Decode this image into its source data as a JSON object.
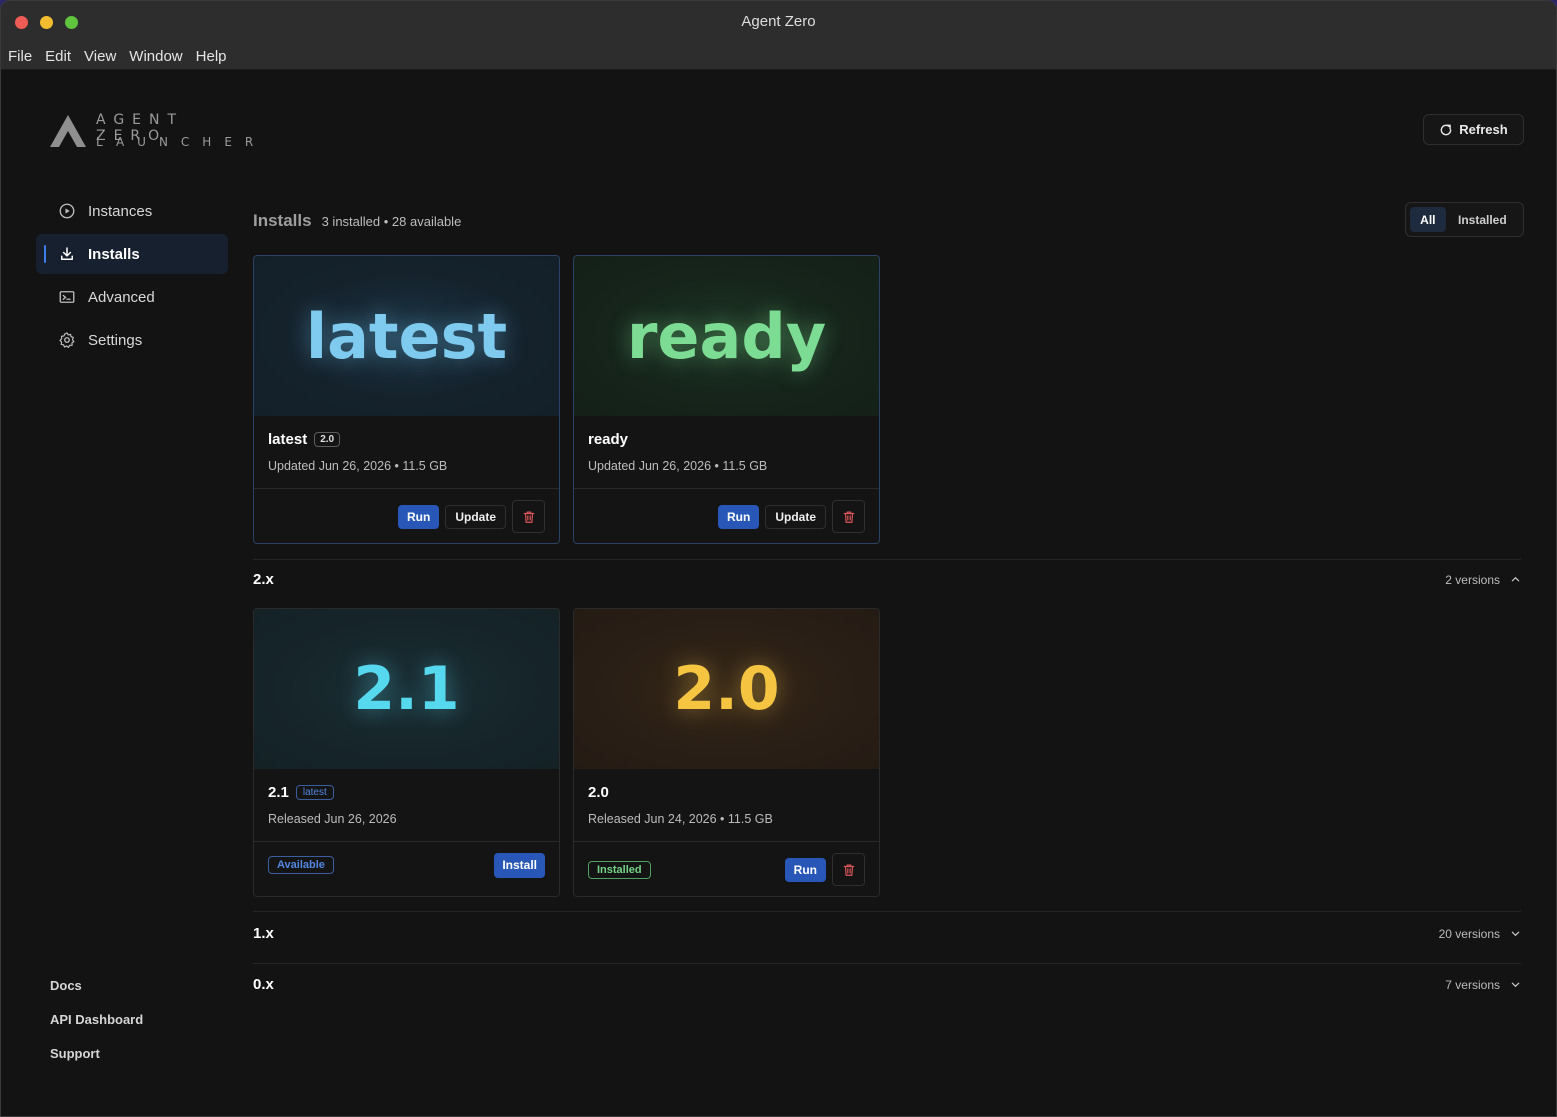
{
  "window": {
    "title": "Agent Zero"
  },
  "menu": [
    "File",
    "Edit",
    "View",
    "Window",
    "Help"
  ],
  "logo": {
    "line1": "AGENT ZERO",
    "line2": "LAUNCHER"
  },
  "refresh_label": "Refresh",
  "sidebar": {
    "items": [
      {
        "label": "Instances",
        "icon": "play-circle-icon"
      },
      {
        "label": "Installs",
        "icon": "download-icon",
        "active": true
      },
      {
        "label": "Advanced",
        "icon": "terminal-icon"
      },
      {
        "label": "Settings",
        "icon": "gear-icon"
      }
    ],
    "footer": [
      "Docs",
      "API Dashboard",
      "Support"
    ]
  },
  "installs": {
    "title": "Installs",
    "count": "3 installed • 28 available",
    "filters": {
      "all": "All",
      "installed": "Installed",
      "selected": "All"
    }
  },
  "cards": {
    "latest": {
      "hero": "latest",
      "title": "latest",
      "badge": "2.0",
      "meta": "Updated Jun 26, 2026 • 11.5 GB",
      "run": "Run",
      "update": "Update",
      "hero_color": "#7ecbef"
    },
    "ready": {
      "hero": "ready",
      "title": "ready",
      "meta": "Updated Jun 26, 2026 • 11.5 GB",
      "run": "Run",
      "update": "Update",
      "hero_color": "#7ddc93"
    },
    "v21": {
      "hero": "2.1",
      "title": "2.1",
      "badge": "latest",
      "meta": "Released Jun 26, 2026",
      "status": "Available",
      "install": "Install",
      "hero_color": "#56d8ee"
    },
    "v20": {
      "hero": "2.0",
      "title": "2.0",
      "meta": "Released Jun 24, 2026 • 11.5 GB",
      "status": "Installed",
      "run": "Run",
      "hero_color": "#f5c542"
    }
  },
  "groups": [
    {
      "label": "2.x",
      "count": "2 versions",
      "expanded": true
    },
    {
      "label": "1.x",
      "count": "20 versions",
      "expanded": false
    },
    {
      "label": "0.x",
      "count": "7 versions",
      "expanded": false
    }
  ]
}
